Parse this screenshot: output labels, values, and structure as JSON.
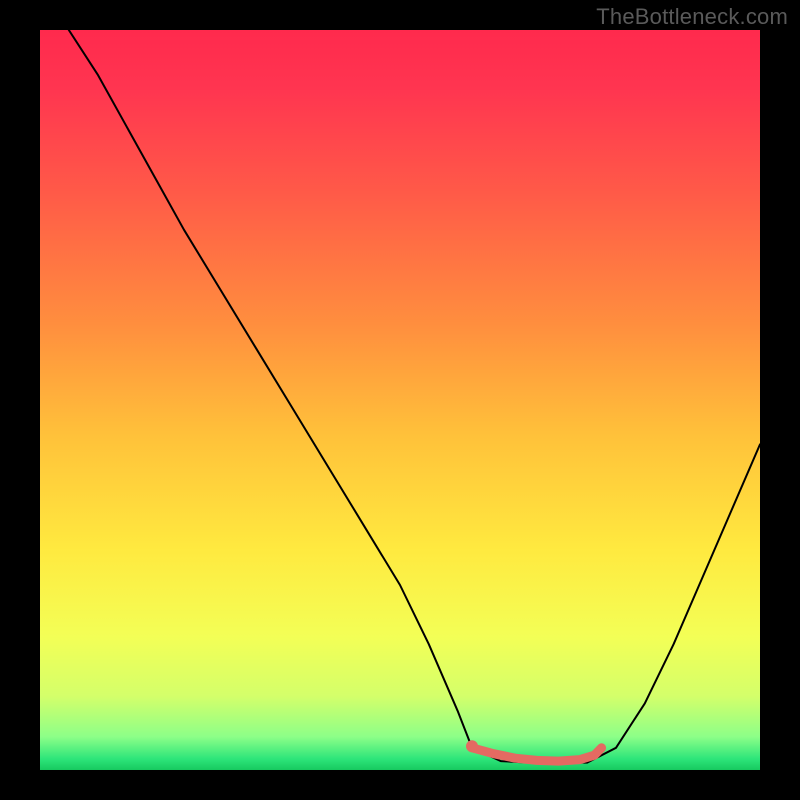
{
  "attribution": "TheBottleneck.com",
  "chart_data": {
    "type": "line",
    "title": "",
    "xlabel": "",
    "ylabel": "",
    "xlim": [
      0,
      100
    ],
    "ylim": [
      0,
      100
    ],
    "grid": false,
    "series": [
      {
        "name": "bottleneck-curve",
        "color": "#000000",
        "stroke_width": 2,
        "x": [
          4,
          8,
          12,
          16,
          20,
          25,
          30,
          35,
          40,
          45,
          50,
          54,
          58,
          60,
          64,
          68,
          72,
          76,
          80,
          84,
          88,
          92,
          96,
          100
        ],
        "values": [
          100,
          94,
          87,
          80,
          73,
          65,
          57,
          49,
          41,
          33,
          25,
          17,
          8,
          3,
          1.2,
          1.0,
          1.0,
          1.0,
          3,
          9,
          17,
          26,
          35,
          44
        ]
      },
      {
        "name": "optimal-range",
        "color": "#e46a62",
        "stroke_width": 9,
        "x": [
          60,
          63,
          66,
          69,
          72,
          75,
          77,
          78
        ],
        "values": [
          3.0,
          2.2,
          1.6,
          1.3,
          1.2,
          1.4,
          2.0,
          3.0
        ]
      }
    ],
    "markers": [
      {
        "name": "optimal-start-dot",
        "x": 60,
        "y": 3.2,
        "color": "#e46a62",
        "r": 6
      }
    ],
    "background": {
      "type": "vertical-gradient",
      "stops": [
        {
          "offset": 0.0,
          "color": "#ff2a4d"
        },
        {
          "offset": 0.08,
          "color": "#ff3550"
        },
        {
          "offset": 0.22,
          "color": "#ff5a48"
        },
        {
          "offset": 0.4,
          "color": "#ff8f3e"
        },
        {
          "offset": 0.55,
          "color": "#ffc23a"
        },
        {
          "offset": 0.7,
          "color": "#ffe93f"
        },
        {
          "offset": 0.82,
          "color": "#f3ff56"
        },
        {
          "offset": 0.9,
          "color": "#d4ff6a"
        },
        {
          "offset": 0.955,
          "color": "#8dff88"
        },
        {
          "offset": 0.985,
          "color": "#2de57a"
        },
        {
          "offset": 1.0,
          "color": "#17c95f"
        }
      ]
    }
  }
}
